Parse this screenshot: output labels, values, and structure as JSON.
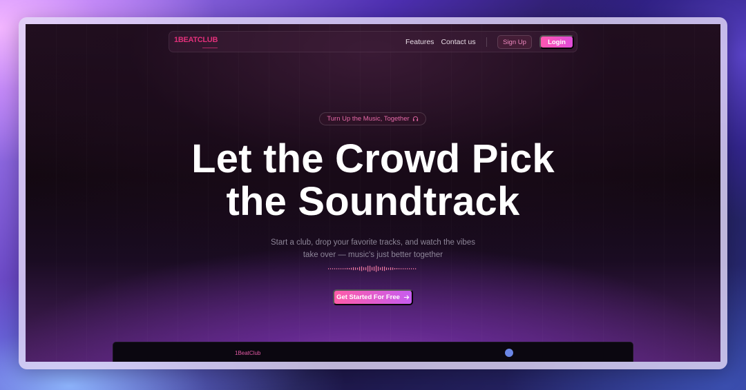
{
  "brand": {
    "logo_text": "1BEATCLUB",
    "accent": "#e0307a"
  },
  "nav": {
    "links": [
      "Features",
      "Contact us"
    ],
    "signup_label": "Sign Up",
    "login_label": "Login"
  },
  "hero": {
    "badge_text": "Turn Up the Music, Together",
    "badge_icon": "headphones-icon",
    "headline_line1": "Let the Crowd Pick",
    "headline_line2": "the Soundtrack",
    "subtitle_line1": "Start a club, drop your favorite tracks, and watch the vibes",
    "subtitle_line2": "take over — music's just better together",
    "cta_label": "Get Started For Free",
    "cta_icon": "arrow-right-icon"
  },
  "preview": {
    "logo_text": "1BeatClub",
    "avatar_color": "#6b86e6"
  },
  "colors": {
    "primary_gradient_start": "#ff57b0",
    "primary_gradient_end": "#c65cf0",
    "background": "#120810"
  }
}
